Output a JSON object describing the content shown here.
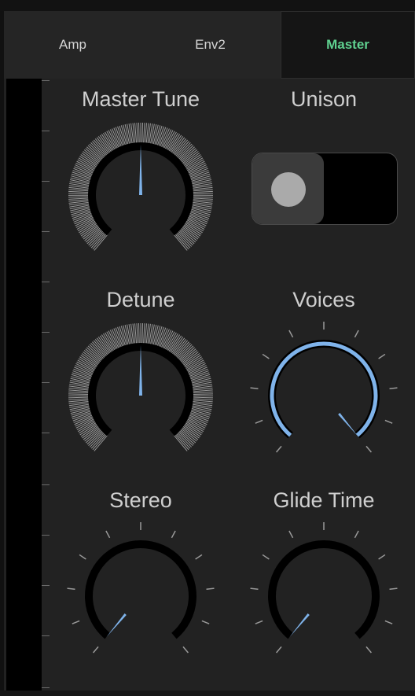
{
  "tabs": [
    {
      "label": "Amp",
      "active": false
    },
    {
      "label": "Env2",
      "active": false
    },
    {
      "label": "Master",
      "active": true
    }
  ],
  "controls": {
    "master_tune": {
      "label": "Master Tune",
      "value": 0.5,
      "style": "fine"
    },
    "unison": {
      "label": "Unison",
      "state": "off"
    },
    "detune": {
      "label": "Detune",
      "value": 0.5,
      "style": "fine"
    },
    "voices": {
      "label": "Voices",
      "value": 1.0,
      "style": "coarse-active"
    },
    "stereo": {
      "label": "Stereo",
      "value": 0.0,
      "style": "coarse"
    },
    "glide_time": {
      "label": "Glide Time",
      "value": 0.0,
      "style": "coarse"
    }
  },
  "colors": {
    "accent": "#7fb3ea",
    "active_tab_text": "#5fd08f",
    "label_text": "#cfcfcf",
    "panel": "#222222"
  }
}
